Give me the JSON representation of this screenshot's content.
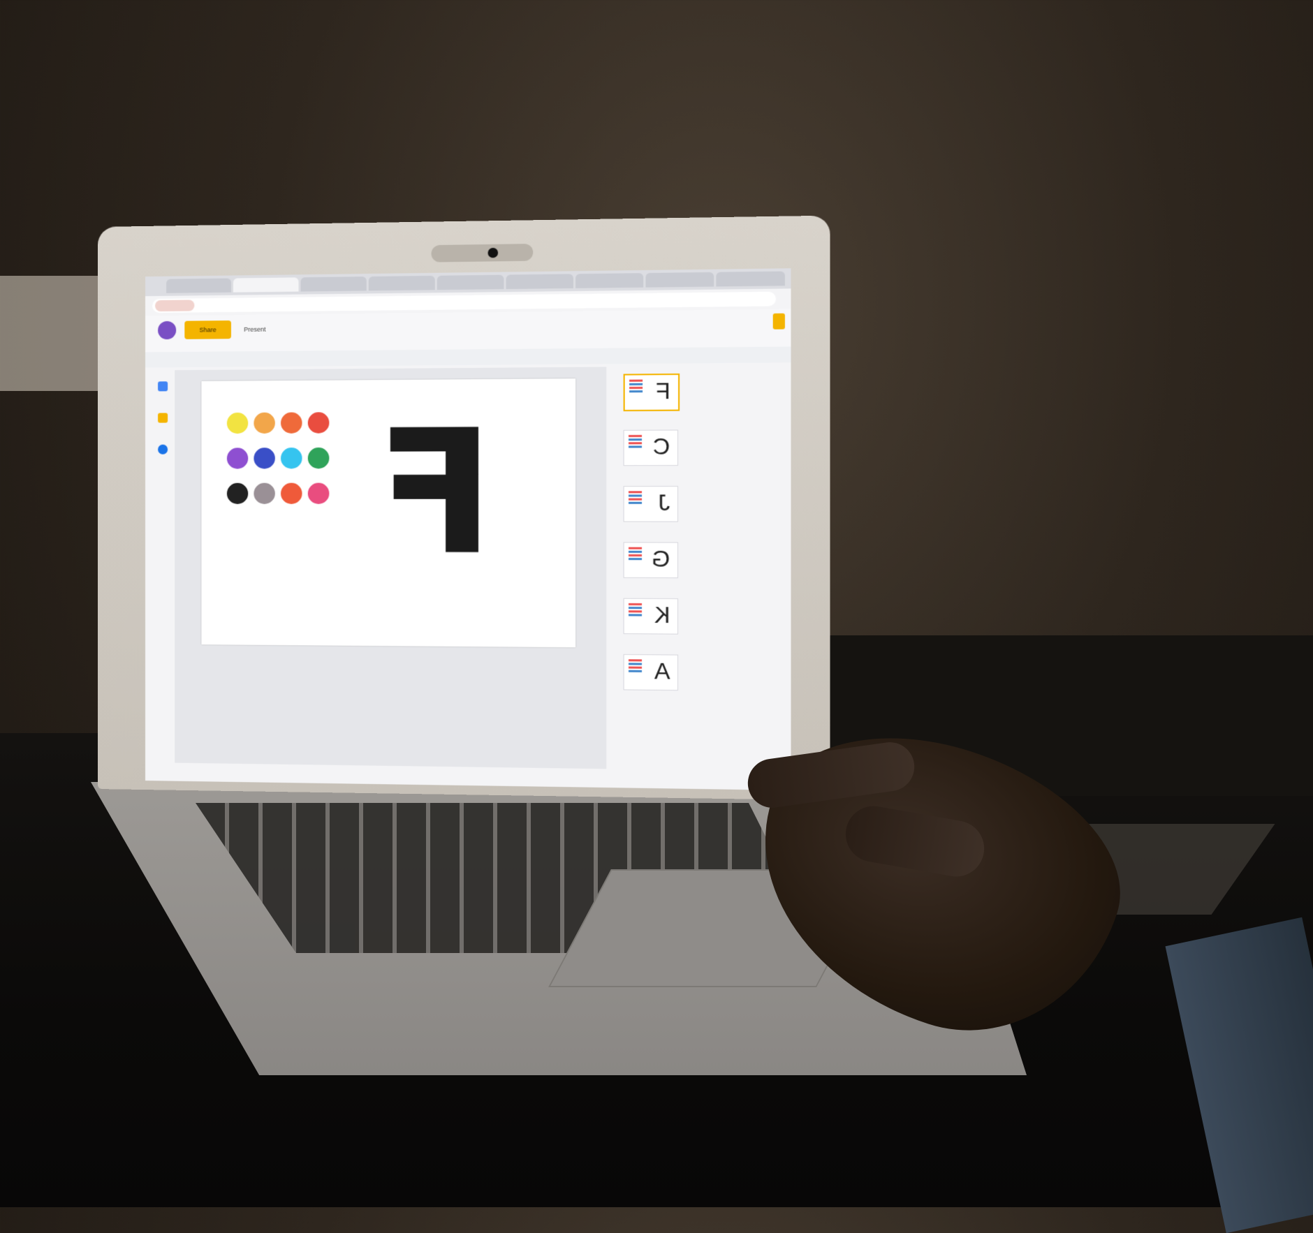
{
  "browser": {
    "tabs": [
      "",
      "",
      "",
      "",
      "",
      "",
      "",
      "",
      ""
    ],
    "resume_label": "",
    "address": ""
  },
  "app": {
    "title": "",
    "share_label": "Share",
    "present_label": "Present",
    "menu": "",
    "toolbar": "",
    "notes_hint": ""
  },
  "slide": {
    "letter": "F",
    "dot_colors": [
      "#e94d3f",
      "#ef6a3a",
      "#f2a64a",
      "#f2e341",
      "#2fa35a",
      "#35c4ef",
      "#3a4fc7",
      "#8e4fd1",
      "#e94d7f",
      "#ef5a3a",
      "#9a9096",
      "#222222"
    ]
  },
  "filmstrip": {
    "letters": [
      "F",
      "C",
      "J",
      "G",
      "K",
      "A"
    ]
  },
  "colors": {
    "accent": "#f4b400",
    "avatar": "#7a4fc4"
  }
}
